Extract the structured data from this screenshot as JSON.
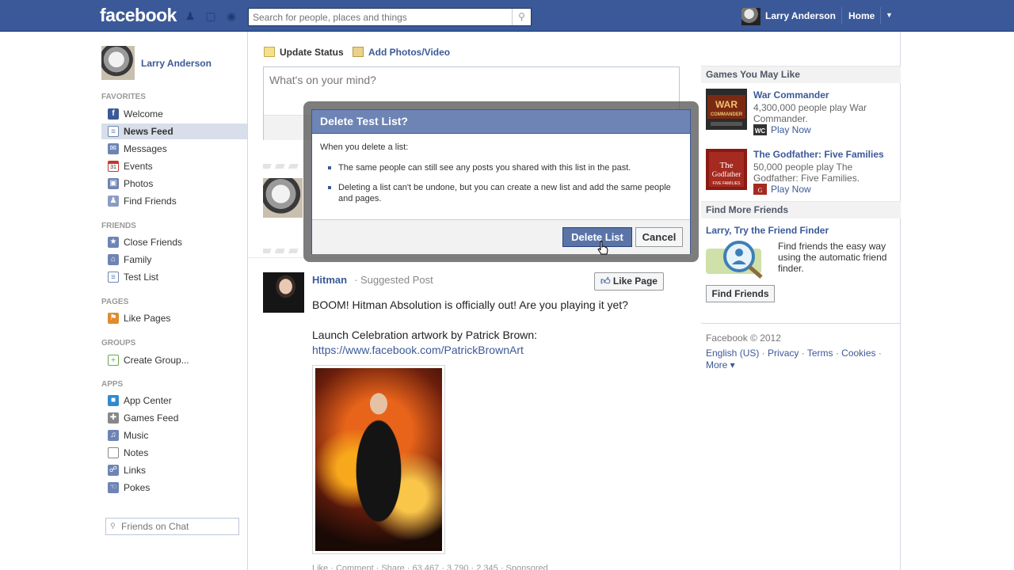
{
  "topbar": {
    "logo": "facebook",
    "search_placeholder": "Search for people, places and things",
    "user_name": "Larry Anderson",
    "home_label": "Home"
  },
  "left": {
    "profile_name": "Larry Anderson",
    "sections": {
      "favorites": "FAVORITES",
      "friends": "FRIENDS",
      "pages": "PAGES",
      "groups": "GROUPS",
      "apps": "APPS"
    },
    "favorites": [
      {
        "label": "Welcome",
        "icon": "facebook-icon",
        "color": "#3b5998"
      },
      {
        "label": "News Feed",
        "icon": "news-feed-icon",
        "color": "#6d84b4"
      },
      {
        "label": "Messages",
        "icon": "messages-icon",
        "color": "#6d84b4"
      },
      {
        "label": "Events",
        "icon": "events-icon",
        "color": "#c0392b"
      },
      {
        "label": "Photos",
        "icon": "photos-icon",
        "color": "#6d84b4"
      },
      {
        "label": "Find Friends",
        "icon": "find-friends-icon",
        "color": "#6d84b4"
      }
    ],
    "friends": [
      {
        "label": "Close Friends",
        "icon": "star-icon"
      },
      {
        "label": "Family",
        "icon": "house-icon"
      },
      {
        "label": "Test List",
        "icon": "list-icon"
      }
    ],
    "pages": [
      {
        "label": "Like Pages",
        "icon": "like-pages-icon"
      }
    ],
    "groups": [
      {
        "label": "Create Group...",
        "icon": "create-group-icon"
      }
    ],
    "apps": [
      {
        "label": "App Center",
        "icon": "app-center-icon"
      },
      {
        "label": "Games Feed",
        "icon": "games-feed-icon"
      },
      {
        "label": "Music",
        "icon": "music-icon"
      },
      {
        "label": "Notes",
        "icon": "notes-icon"
      },
      {
        "label": "Links",
        "icon": "links-icon"
      },
      {
        "label": "Pokes",
        "icon": "pokes-icon"
      }
    ],
    "chat_search_placeholder": "Friends on Chat"
  },
  "composer": {
    "tab_status": "Update Status",
    "tab_photos": "Add Photos/Video",
    "placeholder": "What's on your mind?"
  },
  "post": {
    "author": "Hitman",
    "subtitle": "· Suggested Post",
    "like_page": "Like Page",
    "text1": "BOOM! Hitman Absolution is officially out! Are you playing it yet?",
    "text2": "Launch Celebration artwork by Patrick Brown:",
    "link": "https://www.facebook.com/PatrickBrownArt",
    "footer": "Like · Comment · Share · 63,467 · 3,790 · 2,345 · Sponsored"
  },
  "right": {
    "games_header": "Games You May Like",
    "games": [
      {
        "title": "War Commander",
        "desc": "4,300,000 people play War Commander.",
        "play": "Play Now"
      },
      {
        "title": "The Godfather: Five Families",
        "desc": "50,000 people play The Godfather: Five Families.",
        "play": "Play Now"
      }
    ],
    "friends_header": "Find More Friends",
    "ff_title": "Larry, Try the Friend Finder",
    "ff_desc": "Find friends the easy way using the automatic friend finder.",
    "ff_button": "Find Friends",
    "copyright": "Facebook © 2012",
    "links": [
      "English (US)",
      "Privacy",
      "Terms",
      "Cookies",
      "More ▾"
    ]
  },
  "dialog": {
    "title": "Delete Test List?",
    "intro": "When you delete a list:",
    "bullets": [
      "The same people can still see any posts you shared with this list in the past.",
      "Deleting a list can't be undone, but you can create a new list and add the same people and pages."
    ],
    "delete_label": "Delete List",
    "cancel_label": "Cancel"
  },
  "colors": {
    "brand": "#3b5998",
    "dialog_header": "#6d84b4",
    "nav_active": "#d8dfea"
  }
}
